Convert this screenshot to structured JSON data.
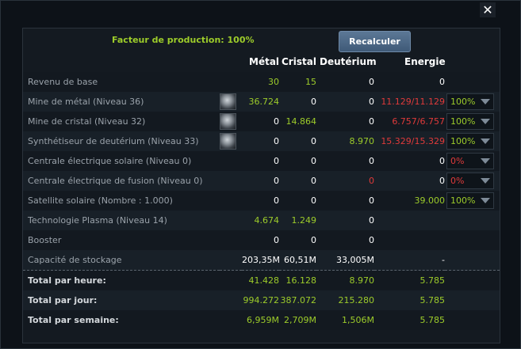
{
  "close": "✕",
  "factor": "Facteur de production: 100%",
  "recalc": "Recalculer",
  "headers": {
    "metal": "Métal",
    "cristal": "Cristal",
    "deuterium": "Deutérium",
    "energie": "Energie"
  },
  "rows": [
    {
      "label": "Revenu de base",
      "metal": "30",
      "cristal": "15",
      "deut": "0",
      "energie": "0"
    },
    {
      "label": "Mine de métal (Niveau 36)",
      "metal": "36.724",
      "cristal": "0",
      "deut": "0",
      "energie": "11.129/11.129",
      "select": "100%"
    },
    {
      "label": "Mine de cristal (Niveau 32)",
      "metal": "0",
      "cristal": "14.864",
      "deut": "0",
      "energie": "6.757/6.757",
      "select": "100%"
    },
    {
      "label": "Synthétiseur de deutérium (Niveau 33)",
      "metal": "0",
      "cristal": "0",
      "deut": "8.970",
      "energie": "15.329/15.329",
      "select": "100%"
    },
    {
      "label": "Centrale électrique solaire (Niveau 0)",
      "metal": "0",
      "cristal": "0",
      "deut": "0",
      "energie": "0",
      "select": "0%"
    },
    {
      "label": "Centrale électrique de fusion (Niveau 0)",
      "metal": "0",
      "cristal": "0",
      "deut": "0",
      "energie": "0",
      "select": "0%"
    },
    {
      "label": "Satellite solaire (Nombre : 1.000)",
      "metal": "0",
      "cristal": "0",
      "deut": "0",
      "energie": "39.000",
      "select": "100%"
    },
    {
      "label": "Technologie Plasma (Niveau 14)",
      "metal": "4.674",
      "cristal": "1.249",
      "deut": "0",
      "energie": ""
    },
    {
      "label": "Booster",
      "metal": "0",
      "cristal": "0",
      "deut": "0",
      "energie": ""
    },
    {
      "label": "Capacité de stockage",
      "metal": "203,35M",
      "cristal": "60,51M",
      "deut": "33,005M",
      "energie": "-"
    },
    {
      "label": "Total par heure:",
      "metal": "41.428",
      "cristal": "16.128",
      "deut": "8.970",
      "energie": "5.785"
    },
    {
      "label": "Total par jour:",
      "metal": "994.272",
      "cristal": "387.072",
      "deut": "215.280",
      "energie": "5.785"
    },
    {
      "label": "Total par semaine:",
      "metal": "6,959M",
      "cristal": "2,709M",
      "deut": "1,506M",
      "energie": "5.785"
    }
  ],
  "icons": {
    "mine": "mine-worker-icon",
    "dropdown": "chevron-down-icon"
  },
  "colors": {
    "positive": "#9dcc2a",
    "negative": "#e03a3a",
    "button": "#4c6886"
  }
}
